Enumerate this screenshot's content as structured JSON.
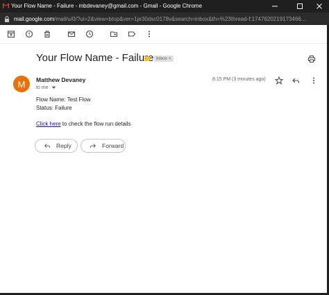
{
  "window": {
    "title": "Your Flow Name - Failure - mbdevaney@gmail.com - Gmail - Google Chrome",
    "icon": "gmail-icon"
  },
  "address": {
    "host": "mail.google.com",
    "path": "/mail/u/0/?ui=2&view=btop&ver=1je30dsc0178v&search=inbox&th=%23thread-f:1747620219173466..."
  },
  "toolbar": {
    "icons": [
      "archive-icon",
      "report-spam-icon",
      "delete-icon",
      "mark-unread-icon",
      "snooze-icon",
      "move-to-icon",
      "label-icon",
      "more-vert-icon"
    ]
  },
  "email": {
    "subject": "Your Flow Name - Failure",
    "label": "Inbox",
    "label_close": "×",
    "sender_initial": "M",
    "sender_name": "Matthew Devaney",
    "to": "to me",
    "time": "8:15 PM (3 minutes ago)",
    "body_line1": "Flow Name: Test Flow",
    "body_line2": "Status: Failure",
    "link_text": "Click here",
    "link_suffix": " to check the flow run details"
  },
  "actions": {
    "reply": "Reply",
    "forward": "Forward"
  },
  "colors": {
    "avatar": "#e8710a",
    "importance_marker": "#f6bf26",
    "link": "#1a0dab",
    "titlebar": "#1f1f1f"
  }
}
